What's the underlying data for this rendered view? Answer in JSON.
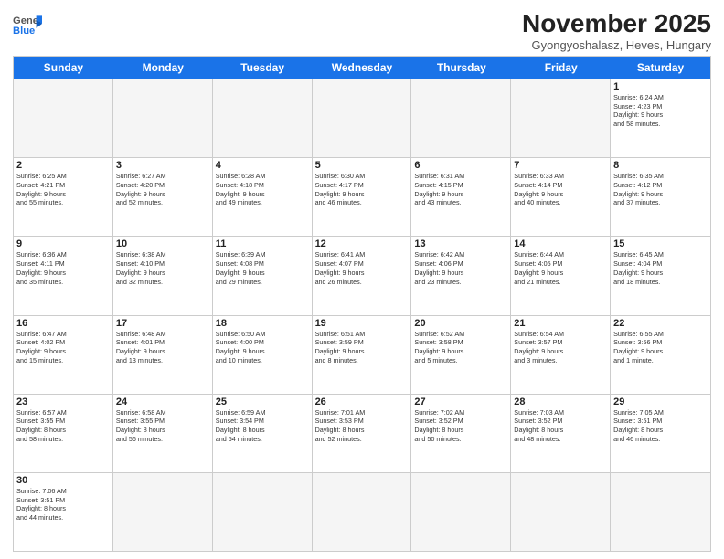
{
  "header": {
    "logo_general": "General",
    "logo_blue": "Blue",
    "month": "November 2025",
    "location": "Gyongyoshalasz, Heves, Hungary"
  },
  "weekdays": [
    "Sunday",
    "Monday",
    "Tuesday",
    "Wednesday",
    "Thursday",
    "Friday",
    "Saturday"
  ],
  "rows": [
    [
      {
        "day": "",
        "info": ""
      },
      {
        "day": "",
        "info": ""
      },
      {
        "day": "",
        "info": ""
      },
      {
        "day": "",
        "info": ""
      },
      {
        "day": "",
        "info": ""
      },
      {
        "day": "",
        "info": ""
      },
      {
        "day": "1",
        "info": "Sunrise: 6:24 AM\nSunset: 4:23 PM\nDaylight: 9 hours\nand 58 minutes."
      }
    ],
    [
      {
        "day": "2",
        "info": "Sunrise: 6:25 AM\nSunset: 4:21 PM\nDaylight: 9 hours\nand 55 minutes."
      },
      {
        "day": "3",
        "info": "Sunrise: 6:27 AM\nSunset: 4:20 PM\nDaylight: 9 hours\nand 52 minutes."
      },
      {
        "day": "4",
        "info": "Sunrise: 6:28 AM\nSunset: 4:18 PM\nDaylight: 9 hours\nand 49 minutes."
      },
      {
        "day": "5",
        "info": "Sunrise: 6:30 AM\nSunset: 4:17 PM\nDaylight: 9 hours\nand 46 minutes."
      },
      {
        "day": "6",
        "info": "Sunrise: 6:31 AM\nSunset: 4:15 PM\nDaylight: 9 hours\nand 43 minutes."
      },
      {
        "day": "7",
        "info": "Sunrise: 6:33 AM\nSunset: 4:14 PM\nDaylight: 9 hours\nand 40 minutes."
      },
      {
        "day": "8",
        "info": "Sunrise: 6:35 AM\nSunset: 4:12 PM\nDaylight: 9 hours\nand 37 minutes."
      }
    ],
    [
      {
        "day": "9",
        "info": "Sunrise: 6:36 AM\nSunset: 4:11 PM\nDaylight: 9 hours\nand 35 minutes."
      },
      {
        "day": "10",
        "info": "Sunrise: 6:38 AM\nSunset: 4:10 PM\nDaylight: 9 hours\nand 32 minutes."
      },
      {
        "day": "11",
        "info": "Sunrise: 6:39 AM\nSunset: 4:08 PM\nDaylight: 9 hours\nand 29 minutes."
      },
      {
        "day": "12",
        "info": "Sunrise: 6:41 AM\nSunset: 4:07 PM\nDaylight: 9 hours\nand 26 minutes."
      },
      {
        "day": "13",
        "info": "Sunrise: 6:42 AM\nSunset: 4:06 PM\nDaylight: 9 hours\nand 23 minutes."
      },
      {
        "day": "14",
        "info": "Sunrise: 6:44 AM\nSunset: 4:05 PM\nDaylight: 9 hours\nand 21 minutes."
      },
      {
        "day": "15",
        "info": "Sunrise: 6:45 AM\nSunset: 4:04 PM\nDaylight: 9 hours\nand 18 minutes."
      }
    ],
    [
      {
        "day": "16",
        "info": "Sunrise: 6:47 AM\nSunset: 4:02 PM\nDaylight: 9 hours\nand 15 minutes."
      },
      {
        "day": "17",
        "info": "Sunrise: 6:48 AM\nSunset: 4:01 PM\nDaylight: 9 hours\nand 13 minutes."
      },
      {
        "day": "18",
        "info": "Sunrise: 6:50 AM\nSunset: 4:00 PM\nDaylight: 9 hours\nand 10 minutes."
      },
      {
        "day": "19",
        "info": "Sunrise: 6:51 AM\nSunset: 3:59 PM\nDaylight: 9 hours\nand 8 minutes."
      },
      {
        "day": "20",
        "info": "Sunrise: 6:52 AM\nSunset: 3:58 PM\nDaylight: 9 hours\nand 5 minutes."
      },
      {
        "day": "21",
        "info": "Sunrise: 6:54 AM\nSunset: 3:57 PM\nDaylight: 9 hours\nand 3 minutes."
      },
      {
        "day": "22",
        "info": "Sunrise: 6:55 AM\nSunset: 3:56 PM\nDaylight: 9 hours\nand 1 minute."
      }
    ],
    [
      {
        "day": "23",
        "info": "Sunrise: 6:57 AM\nSunset: 3:55 PM\nDaylight: 8 hours\nand 58 minutes."
      },
      {
        "day": "24",
        "info": "Sunrise: 6:58 AM\nSunset: 3:55 PM\nDaylight: 8 hours\nand 56 minutes."
      },
      {
        "day": "25",
        "info": "Sunrise: 6:59 AM\nSunset: 3:54 PM\nDaylight: 8 hours\nand 54 minutes."
      },
      {
        "day": "26",
        "info": "Sunrise: 7:01 AM\nSunset: 3:53 PM\nDaylight: 8 hours\nand 52 minutes."
      },
      {
        "day": "27",
        "info": "Sunrise: 7:02 AM\nSunset: 3:52 PM\nDaylight: 8 hours\nand 50 minutes."
      },
      {
        "day": "28",
        "info": "Sunrise: 7:03 AM\nSunset: 3:52 PM\nDaylight: 8 hours\nand 48 minutes."
      },
      {
        "day": "29",
        "info": "Sunrise: 7:05 AM\nSunset: 3:51 PM\nDaylight: 8 hours\nand 46 minutes."
      }
    ],
    [
      {
        "day": "30",
        "info": "Sunrise: 7:06 AM\nSunset: 3:51 PM\nDaylight: 8 hours\nand 44 minutes."
      },
      {
        "day": "",
        "info": ""
      },
      {
        "day": "",
        "info": ""
      },
      {
        "day": "",
        "info": ""
      },
      {
        "day": "",
        "info": ""
      },
      {
        "day": "",
        "info": ""
      },
      {
        "day": "",
        "info": ""
      }
    ]
  ]
}
